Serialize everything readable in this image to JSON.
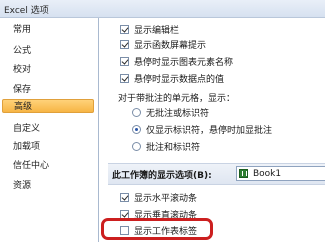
{
  "window": {
    "title": "Excel 选项"
  },
  "sidebar": {
    "items": [
      {
        "label": "常用",
        "active": false
      },
      {
        "label": "公式",
        "active": false
      },
      {
        "label": "校对",
        "active": false
      },
      {
        "label": "保存",
        "active": false
      },
      {
        "label": "高级",
        "active": true
      },
      {
        "label": "自定义",
        "active": false
      },
      {
        "label": "加载项",
        "active": false
      },
      {
        "label": "信任中心",
        "active": false
      },
      {
        "label": "资源",
        "active": false
      }
    ]
  },
  "display_options": [
    {
      "label": "显示编辑栏",
      "checked": true
    },
    {
      "label": "显示函数屏幕提示",
      "checked": true
    },
    {
      "label": "悬停时显示图表元素名称",
      "checked": true
    },
    {
      "label": "悬停时显示数据点的值",
      "checked": true
    }
  ],
  "comments": {
    "label": "对于带批注的单元格，显示：",
    "options": [
      {
        "label": "无批注或标识符",
        "selected": false
      },
      {
        "label": "仅显示标识符，悬停时加显批注",
        "selected": true
      },
      {
        "label": "批注和标识符",
        "selected": false
      }
    ]
  },
  "workbook_section": {
    "title": "此工作簿的显示选项(B):",
    "workbook_value": "Book1",
    "options": [
      {
        "label": "显示水平滚动条",
        "checked": true
      },
      {
        "label": "显示垂直滚动条",
        "checked": true
      },
      {
        "label": "显示工作表标签",
        "checked": false
      }
    ]
  }
}
